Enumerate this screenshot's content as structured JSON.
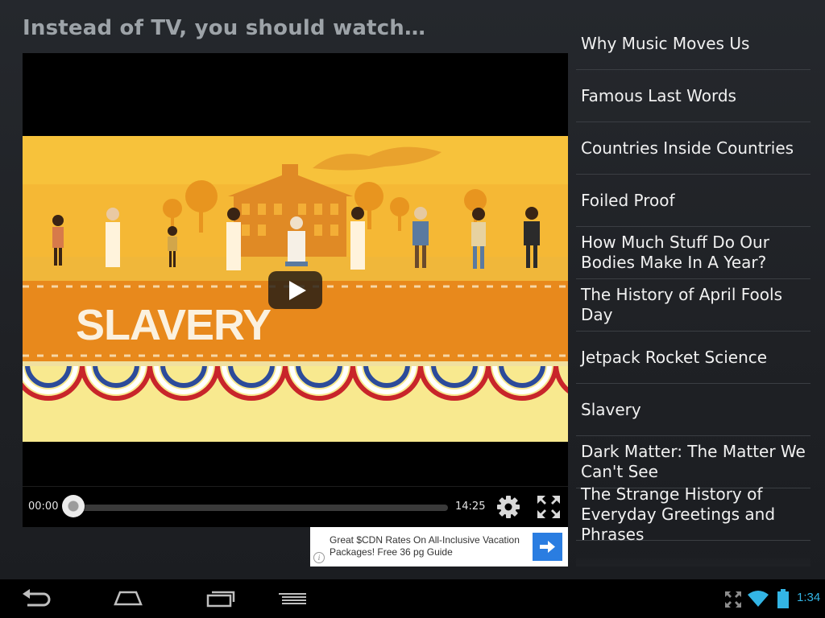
{
  "header": {
    "title": "Instead of TV, you should watch…"
  },
  "player": {
    "video_title_overlay": "SLAVERY",
    "current_time": "00:00",
    "total_time": "14:25",
    "progress": 0.0
  },
  "ad": {
    "text": "Great $CDN Rates On All-Inclusive Vacation Packages! Free 36 pg Guide",
    "info_icon": "i"
  },
  "video_list": {
    "items": [
      {
        "label": "Why Music Moves Us"
      },
      {
        "label": "Famous Last Words"
      },
      {
        "label": "Countries Inside Countries"
      },
      {
        "label": "Foiled Proof"
      },
      {
        "label": "How Much Stuff Do Our Bodies Make In A Year?"
      },
      {
        "label": "The History of April Fools Day"
      },
      {
        "label": "Jetpack Rocket Science"
      },
      {
        "label": "Slavery"
      },
      {
        "label": "Dark Matter: The Matter We Can't See"
      },
      {
        "label": "The Strange History of Everyday Greetings and Phrases"
      }
    ]
  },
  "navbar": {
    "icons": [
      "back-icon",
      "home-icon",
      "recent-apps-icon",
      "menu-icon"
    ],
    "status_icons": [
      "screen-rotate-icon",
      "wifi-icon",
      "battery-icon"
    ],
    "clock": "1:34"
  },
  "colors": {
    "accent_blue": "#33b5e5",
    "ad_button": "#2a7de1",
    "video_orange": "#e8891c",
    "video_yellow": "#f7c23b"
  }
}
